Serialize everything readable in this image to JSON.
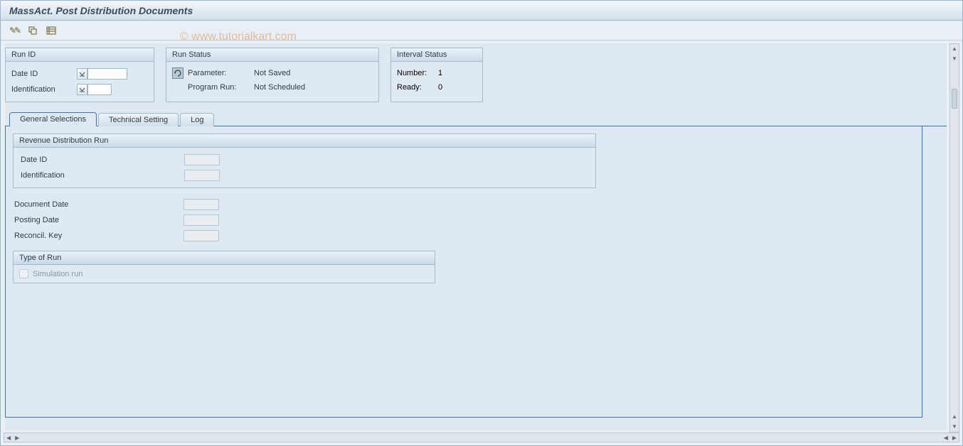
{
  "window": {
    "title": "MassAct. Post Distribution Documents"
  },
  "toolbar": {
    "pencil_icon": "✎✎",
    "copy_icon": "▭",
    "columns_icon": "≣"
  },
  "run_id_box": {
    "title": "Run ID",
    "date_id_label": "Date ID",
    "identification_label": "Identification"
  },
  "run_status_box": {
    "title": "Run Status",
    "parameter_label": "Parameter:",
    "parameter_value": "Not Saved",
    "program_run_label": "Program Run:",
    "program_run_value": "Not Scheduled"
  },
  "interval_box": {
    "title": "Interval Status",
    "number_label": "Number:",
    "number_value": "1",
    "ready_label": "Ready:",
    "ready_value": "0"
  },
  "tabs": {
    "general": "General Selections",
    "technical": "Technical Setting",
    "log": "Log"
  },
  "revenue_box": {
    "title": "Revenue Distribution Run",
    "date_id_label": "Date ID",
    "identification_label": "Identification"
  },
  "dates": {
    "document_date_label": "Document Date",
    "posting_date_label": "Posting Date",
    "reconcil_key_label": "Reconcil. Key"
  },
  "type_of_run": {
    "title": "Type of Run",
    "simulation_label": "Simulation run"
  },
  "watermark": "© www.tutorialkart.com"
}
